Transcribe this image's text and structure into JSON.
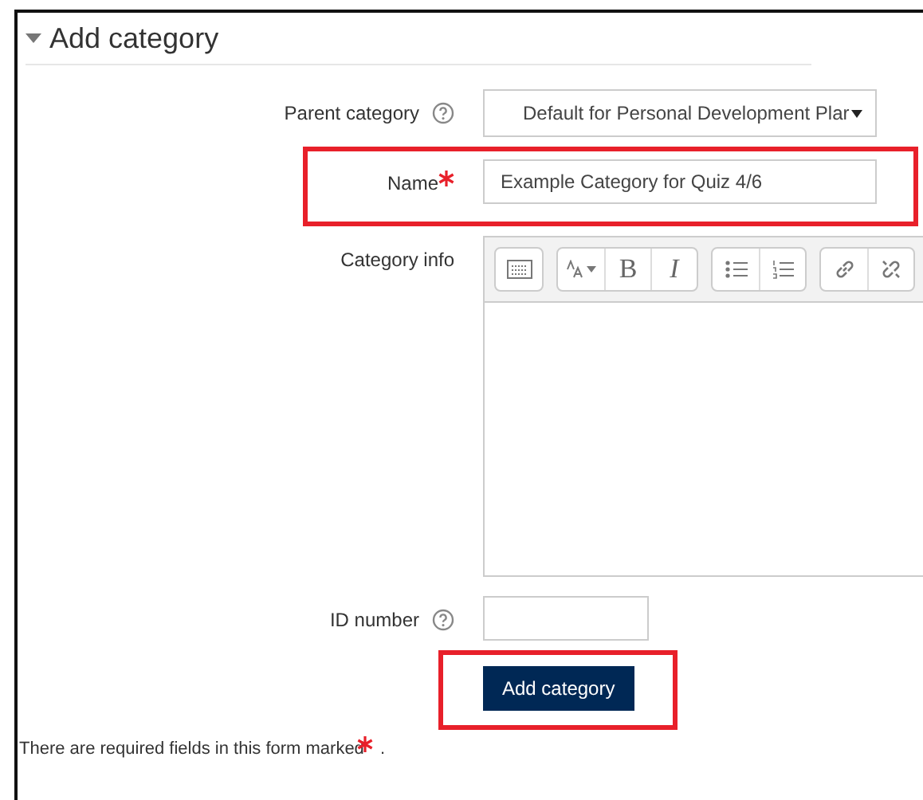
{
  "section": {
    "title": "Add category",
    "expanded": true
  },
  "fields": [
    {
      "kind": "select",
      "label": "Parent category",
      "help": true,
      "required": false,
      "highlighted": false,
      "value": "Default for Personal Development Plar"
    },
    {
      "kind": "text",
      "label": "Name",
      "help": false,
      "required": true,
      "highlighted": true,
      "value": "Example Category for Quiz 4/6"
    },
    {
      "kind": "editor",
      "label": "Category info",
      "help": false,
      "required": false,
      "highlighted": false,
      "toolbar": [
        [
          {
            "kind": "keyboard"
          }
        ],
        [
          {
            "kind": "font-size"
          },
          {
            "kind": "bold",
            "text": "B"
          },
          {
            "kind": "italic",
            "text": "I"
          }
        ],
        [
          {
            "kind": "bullet-list"
          },
          {
            "kind": "numbered-list"
          }
        ],
        [
          {
            "kind": "link"
          },
          {
            "kind": "unlink"
          }
        ]
      ]
    },
    {
      "kind": "short",
      "label": "ID number",
      "help": true,
      "required": false,
      "highlighted": false
    }
  ],
  "submit": {
    "label": "Add category",
    "highlighted": true
  },
  "note": {
    "text": "There are required fields in this form marked",
    "end": "."
  }
}
